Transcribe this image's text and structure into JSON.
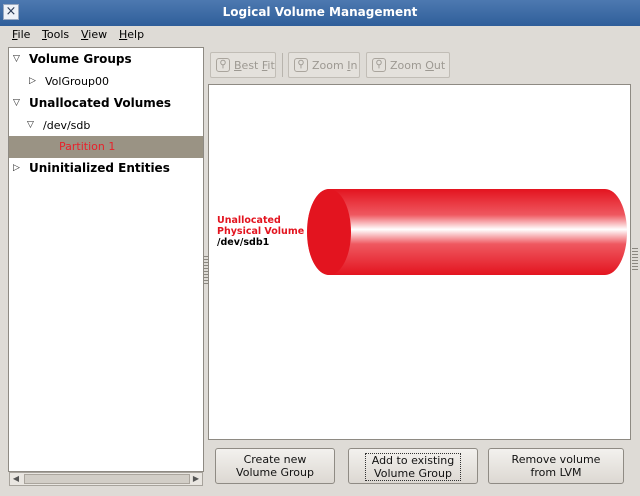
{
  "window": {
    "title": "Logical Volume Management"
  },
  "menubar": {
    "items": [
      {
        "label": "File",
        "mnemonic": "F",
        "rest": "ile"
      },
      {
        "label": "Tools",
        "mnemonic": "T",
        "rest": "ools"
      },
      {
        "label": "View",
        "mnemonic": "V",
        "rest": "iew"
      },
      {
        "label": "Help",
        "mnemonic": "H",
        "rest": "elp"
      }
    ]
  },
  "tree": [
    {
      "label": "Volume Groups",
      "bold": true,
      "expanded": true
    },
    {
      "label": "VolGroup00",
      "bold": false,
      "expanded": false
    },
    {
      "label": "Unallocated Volumes",
      "bold": true,
      "expanded": true
    },
    {
      "label": "/dev/sdb",
      "bold": false,
      "expanded": true
    },
    {
      "label": "Partition 1",
      "bold": false,
      "selected": true
    },
    {
      "label": "Uninitialized Entities",
      "bold": true,
      "expanded": false
    }
  ],
  "toolbar": {
    "best_fit": {
      "mnemonic": "B",
      "rest": "est ",
      "mnemonic2": "F",
      "rest2": "it"
    },
    "zoom_in": {
      "pre": "Zoom ",
      "mnemonic": "I",
      "rest": "n"
    },
    "zoom_out": {
      "pre": "Zoom ",
      "mnemonic": "O",
      "rest": "ut"
    }
  },
  "physical_volume": {
    "line1": "Unallocated",
    "line2": "Physical Volume",
    "device": "/dev/sdb1",
    "color": "#e8212b"
  },
  "actions": {
    "create": {
      "line1": "Create new",
      "line2": "Volume Group"
    },
    "add": {
      "line1": "Add to existing",
      "line2": "Volume Group"
    },
    "remove": {
      "line1": "Remove volume",
      "line2": "from LVM"
    }
  }
}
